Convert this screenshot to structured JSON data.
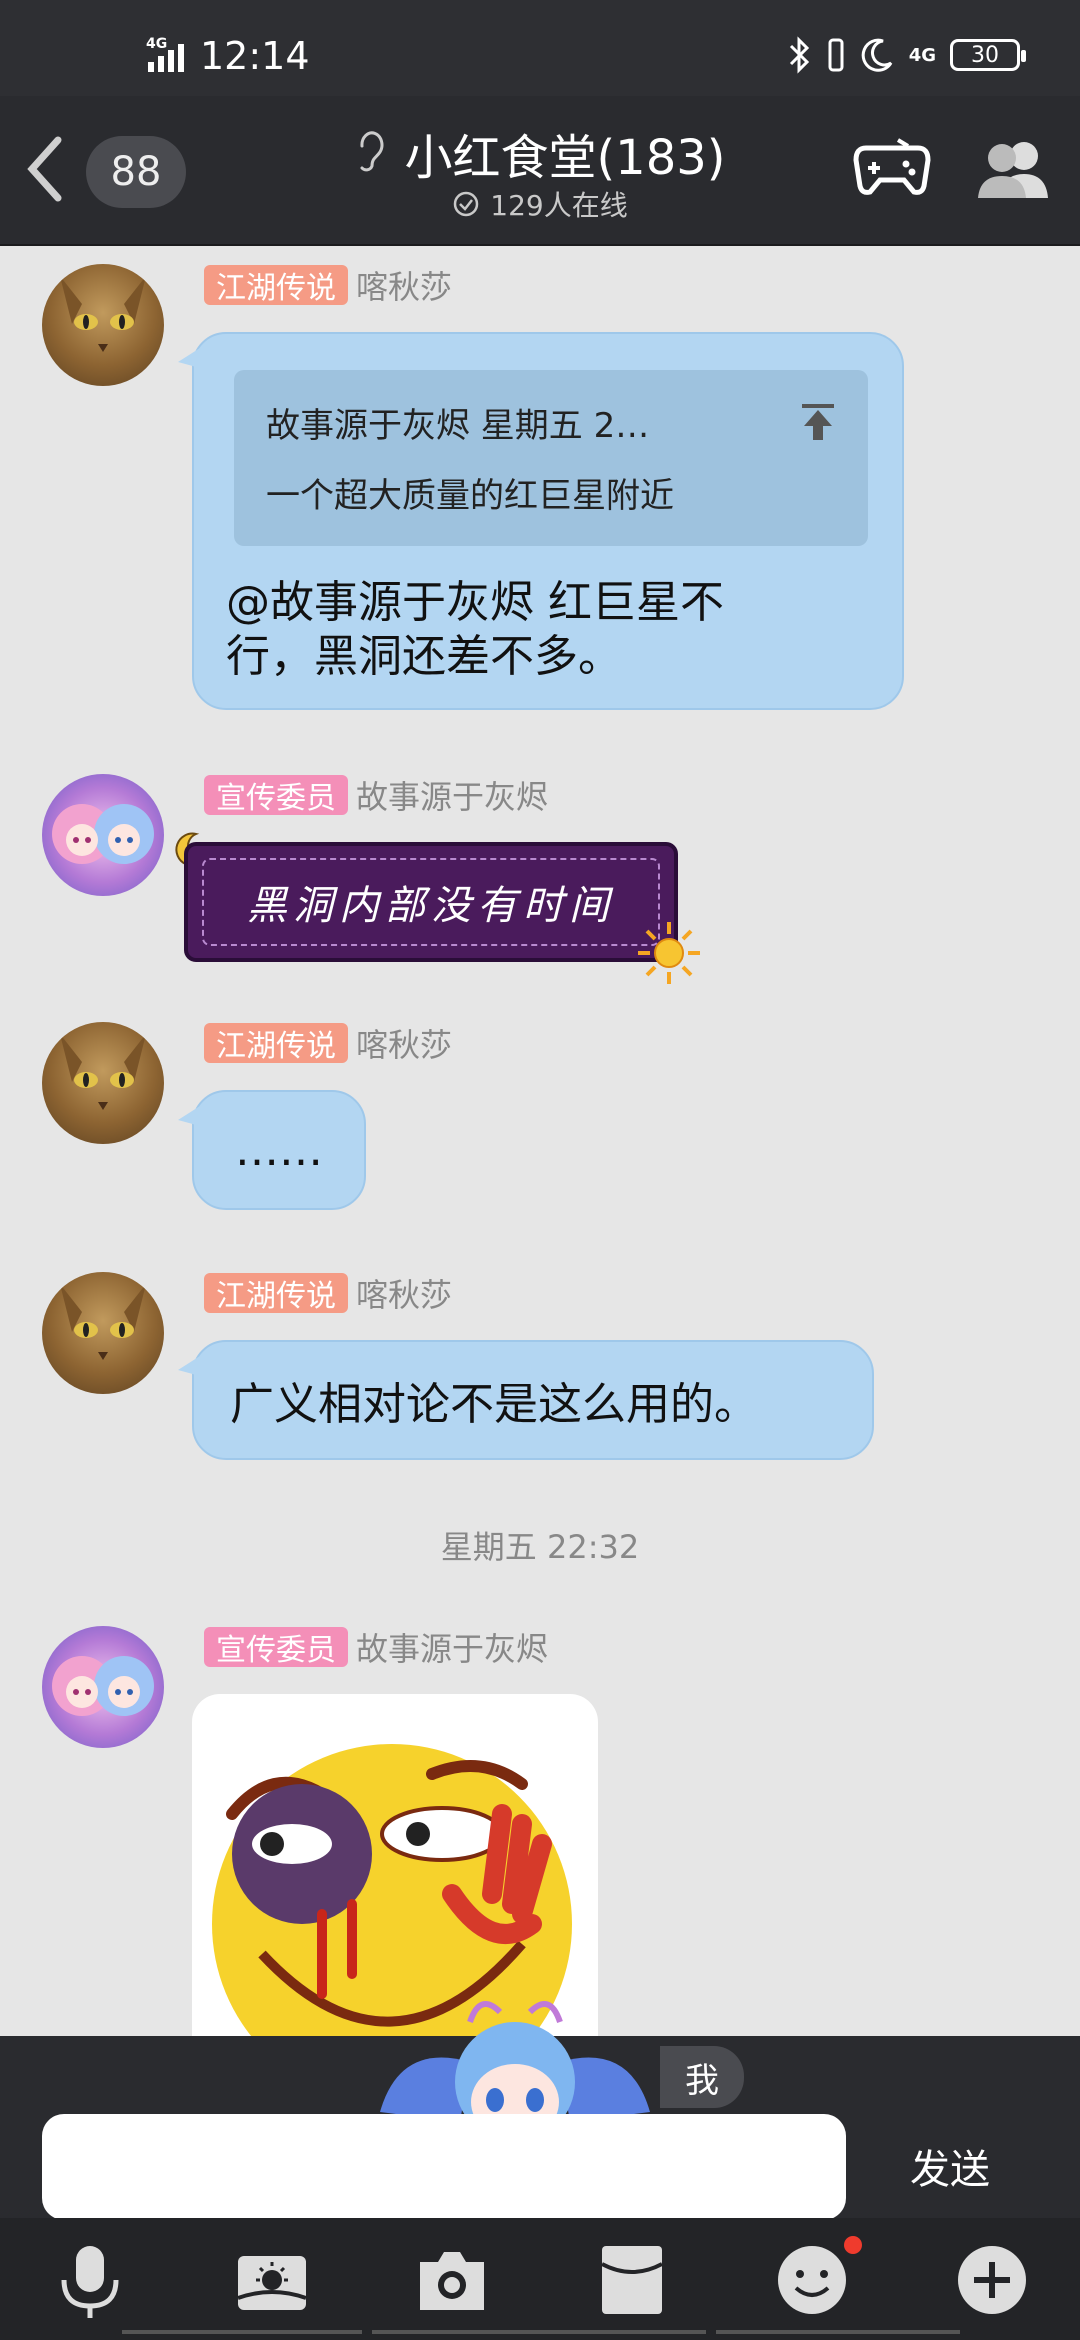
{
  "status_bar": {
    "time": "12:14",
    "net_left": "4G",
    "net_right": "4G",
    "battery": "30"
  },
  "header": {
    "unread_count": "88",
    "group_name": "小红食堂(183)",
    "online_text": "129人在线"
  },
  "messages": [
    {
      "tag": "江湖传说",
      "sender": "喀秋莎",
      "quote_line1": "故事源于灰烬 星期五 2…",
      "quote_line2": "一个超大质量的红巨星附近",
      "text_line1": "@故事源于灰烬 红巨星不",
      "text_line2": "行，黑洞还差不多。"
    },
    {
      "tag": "宣传委员",
      "sender": "故事源于灰烬",
      "text": "黑洞内部没有时间"
    },
    {
      "tag": "江湖传说",
      "sender": "喀秋莎",
      "text": "……"
    },
    {
      "tag": "江湖传说",
      "sender": "喀秋莎",
      "text": "广义相对论不是这么用的。"
    },
    {
      "tag": "宣传委员",
      "sender": "故事源于灰烬"
    }
  ],
  "timestamp": "星期五 22:32",
  "input": {
    "me_label": "我",
    "value": "",
    "send_label": "发送"
  },
  "colors": {
    "header_bg": "#2a2b2f",
    "bubble_bg": "#b3d6f2",
    "chat_bg": "#e6e6e6",
    "tag_jianghu": "#f59b85",
    "tag_xuanchuan": "#f48fb8",
    "notify_dot": "#ef3b2d"
  },
  "toolbar_icons": [
    "microphone-icon",
    "image-icon",
    "camera-icon",
    "red-packet-icon",
    "emoji-icon",
    "plus-icon"
  ]
}
